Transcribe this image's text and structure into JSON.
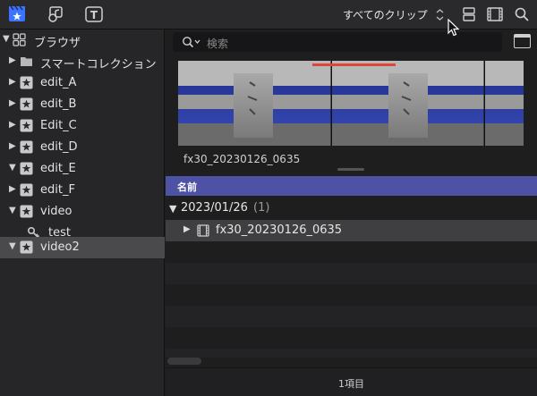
{
  "toolbar": {
    "filter_label": "すべてのクリップ",
    "filter_chevron": "⌃⌄",
    "left_icons": [
      "libraries-icon",
      "photos-audio-icon",
      "titles-icon"
    ],
    "right_icons": [
      "clip-appearance-icon",
      "filmstrip-icon",
      "search-icon"
    ]
  },
  "sidebar": {
    "items": [
      {
        "label": "ブラウザ",
        "icon": "grid-icon",
        "arrow": "▼",
        "indent": 0
      },
      {
        "label": "スマートコレクション",
        "icon": "folder-icon",
        "arrow": "▶",
        "indent": 1
      },
      {
        "label": "edit_A",
        "icon": "event-star-icon",
        "arrow": "▶",
        "indent": 1
      },
      {
        "label": "edit_B",
        "icon": "event-star-icon",
        "arrow": "▶",
        "indent": 1
      },
      {
        "label": "Edit_C",
        "icon": "event-star-icon",
        "arrow": "▶",
        "indent": 1
      },
      {
        "label": "edit_D",
        "icon": "event-star-icon",
        "arrow": "▶",
        "indent": 1
      },
      {
        "label": "edit_E",
        "icon": "event-star-icon",
        "arrow": "▼",
        "indent": 1
      },
      {
        "label": "edit_F",
        "icon": "event-star-icon",
        "arrow": "▶",
        "indent": 1
      },
      {
        "label": "video",
        "icon": "event-star-icon",
        "arrow": "▼",
        "indent": 1
      },
      {
        "label": "test",
        "icon": "keyword-key-icon",
        "arrow": "",
        "indent": 2
      },
      {
        "label": "video2",
        "icon": "event-star-icon",
        "arrow": "▼",
        "indent": 1,
        "selected": true
      }
    ]
  },
  "search": {
    "placeholder": "検索"
  },
  "filmstrip": {
    "clip_name": "fx30_20230126_0635"
  },
  "list": {
    "column_header": "名前",
    "group": {
      "date": "2023/01/26",
      "count": "(1)"
    },
    "clip": {
      "name": "fx30_20230126_0635"
    }
  },
  "status": {
    "text": "1項目"
  },
  "colors": {
    "accent": "#4d52a4",
    "selection": "#4a4a4c",
    "playhead_marker": "#e0453a"
  }
}
